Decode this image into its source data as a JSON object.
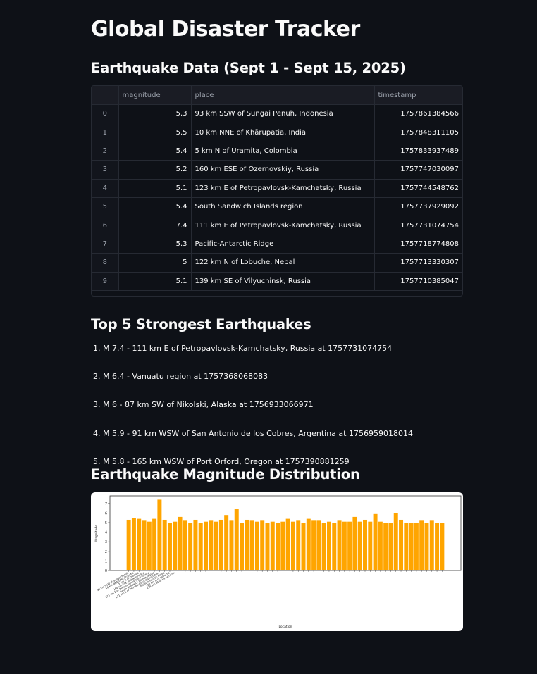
{
  "page": {
    "title": "Global Disaster Tracker"
  },
  "earthquake_data": {
    "heading": "Earthquake Data (Sept 1 - Sept 15, 2025)",
    "columns": [
      "",
      "magnitude",
      "place",
      "timestamp"
    ],
    "rows": [
      {
        "index": "0",
        "magnitude": "5.3",
        "place": "93 km SSW of Sungai Penuh, Indonesia",
        "timestamp": "1757861384566"
      },
      {
        "index": "1",
        "magnitude": "5.5",
        "place": "10 km NNE of Khārupatia, India",
        "timestamp": "1757848311105"
      },
      {
        "index": "2",
        "magnitude": "5.4",
        "place": "5 km N of Uramita, Colombia",
        "timestamp": "1757833937489"
      },
      {
        "index": "3",
        "magnitude": "5.2",
        "place": "160 km ESE of Ozernovskiy, Russia",
        "timestamp": "1757747030097"
      },
      {
        "index": "4",
        "magnitude": "5.1",
        "place": "123 km E of Petropavlovsk-Kamchatsky, Russia",
        "timestamp": "1757744548762"
      },
      {
        "index": "5",
        "magnitude": "5.4",
        "place": "South Sandwich Islands region",
        "timestamp": "1757737929092"
      },
      {
        "index": "6",
        "magnitude": "7.4",
        "place": "111 km E of Petropavlovsk-Kamchatsky, Russia",
        "timestamp": "1757731074754"
      },
      {
        "index": "7",
        "magnitude": "5.3",
        "place": "Pacific-Antarctic Ridge",
        "timestamp": "1757718774808"
      },
      {
        "index": "8",
        "magnitude": "5",
        "place": "122 km N of Lobuche, Nepal",
        "timestamp": "1757713330307"
      },
      {
        "index": "9",
        "magnitude": "5.1",
        "place": "139 km SE of Vilyuchinsk, Russia",
        "timestamp": "1757710385047"
      }
    ]
  },
  "top5": {
    "heading": "Top 5 Strongest Earthquakes",
    "items": [
      "M 7.4 - 111 km E of Petropavlovsk-Kamchatsky, Russia at 1757731074754",
      "M 6.4 - Vanuatu region at 1757368068083",
      "M 6 - 87 km SW of Nikolski, Alaska at 1756933066971",
      "M 5.9 - 91 km WSW of San Antonio de los Cobres, Argentina at 1756959018014",
      "M 5.8 - 165 km WSW of Port Orford, Oregon at 1757390881259"
    ]
  },
  "distribution": {
    "heading": "Earthquake Magnitude Distribution"
  },
  "colors": {
    "background": "#0e1117",
    "bar": "#ffa500"
  },
  "chart_data": {
    "type": "bar",
    "xlabel": "Location",
    "ylabel": "Magnitude",
    "ylim": [
      0,
      7.8
    ],
    "yticks": [
      0,
      1,
      2,
      3,
      4,
      5,
      6,
      7
    ],
    "grid": false,
    "categories": [
      "93 km SSW of Sungai Penuh",
      "10 km NNE of Khārupatia",
      "5 km N of Uramita",
      "160 km ESE of Ozernovskiy",
      "123 km E of Petropavlovsk-Kamchatsky",
      "South Sandwich Islands region",
      "111 km E of Petropavlovsk-Kamchatsky",
      "Pacific-Antarctic Ridge",
      "122 km N of Lobuche",
      "139 km SE of Vilyuchinsk"
    ],
    "values": [
      5.3,
      5.5,
      5.4,
      5.2,
      5.1,
      5.4,
      7.4,
      5.3,
      5.0,
      5.1,
      5.6,
      5.2,
      5.0,
      5.3,
      5.0,
      5.1,
      5.2,
      5.1,
      5.3,
      5.8,
      5.2,
      6.4,
      5.0,
      5.3,
      5.2,
      5.1,
      5.2,
      5.0,
      5.1,
      5.0,
      5.1,
      5.4,
      5.1,
      5.2,
      5.0,
      5.4,
      5.2,
      5.2,
      5.0,
      5.1,
      5.0,
      5.2,
      5.1,
      5.1,
      5.6,
      5.1,
      5.3,
      5.1,
      5.9,
      5.1,
      5.0,
      5.0,
      6.0,
      5.3,
      5.0,
      5.0,
      5.0,
      5.2,
      5.0,
      5.2,
      5.0,
      5.0
    ]
  }
}
